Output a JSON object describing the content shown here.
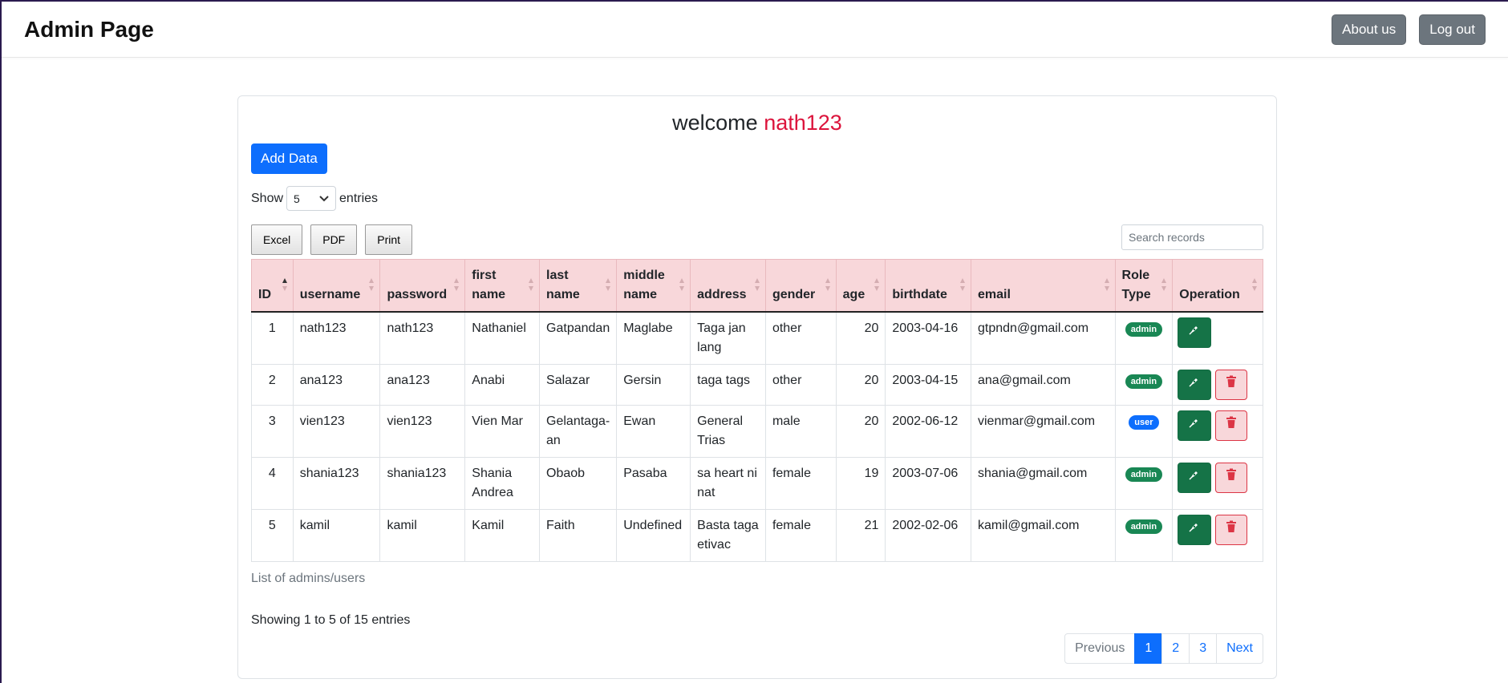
{
  "navbar": {
    "brand": "Admin Page",
    "about_label": "About us",
    "logout_label": "Log out"
  },
  "welcome": {
    "prefix": "welcome",
    "username": "nath123"
  },
  "add_button": "Add Data",
  "length": {
    "show": "Show",
    "value": "5",
    "entries": "entries"
  },
  "export": {
    "excel": "Excel",
    "pdf": "PDF",
    "print": "Print"
  },
  "search": {
    "placeholder": "Search records",
    "value": ""
  },
  "table": {
    "headers": [
      "ID",
      "username",
      "password",
      "first name",
      "last name",
      "middle name",
      "address",
      "gender",
      "age",
      "birthdate",
      "email",
      "Role Type",
      "Operation"
    ],
    "rows": [
      {
        "id": "1",
        "username": "nath123",
        "password": "nath123",
        "first": "Nathaniel",
        "last": "Gatpandan",
        "middle": "Maglabe",
        "address": "Taga jan lang",
        "gender": "other",
        "age": "20",
        "birthdate": "2003-04-16",
        "email": "gtpndn@gmail.com",
        "role": "admin"
      },
      {
        "id": "2",
        "username": "ana123",
        "password": "ana123",
        "first": "Anabi",
        "last": "Salazar",
        "middle": "Gersin",
        "address": "taga tags",
        "gender": "other",
        "age": "20",
        "birthdate": "2003-04-15",
        "email": "ana@gmail.com",
        "role": "admin"
      },
      {
        "id": "3",
        "username": "vien123",
        "password": "vien123",
        "first": "Vien Mar",
        "last": "Gelantaga-an",
        "middle": "Ewan",
        "address": "General Trias",
        "gender": "male",
        "age": "20",
        "birthdate": "2002-06-12",
        "email": "vienmar@gmail.com",
        "role": "user"
      },
      {
        "id": "4",
        "username": "shania123",
        "password": "shania123",
        "first": "Shania Andrea",
        "last": "Obaob",
        "middle": "Pasaba",
        "address": "sa heart ni nat",
        "gender": "female",
        "age": "19",
        "birthdate": "2003-07-06",
        "email": "shania@gmail.com",
        "role": "admin"
      },
      {
        "id": "5",
        "username": "kamil",
        "password": "kamil",
        "first": "Kamil",
        "last": "Faith",
        "middle": "Undefined",
        "address": "Basta taga etivac",
        "gender": "female",
        "age": "21",
        "birthdate": "2002-02-06",
        "email": "kamil@gmail.com",
        "role": "admin"
      }
    ]
  },
  "caption": "List of admins/users",
  "info": "Showing 1 to 5 of 15 entries",
  "pagination": {
    "previous": "Previous",
    "pages": [
      "1",
      "2",
      "3"
    ],
    "next": "Next",
    "active": "1"
  },
  "icons": {
    "edit": "pen-nib-icon",
    "delete": "trash-icon",
    "sort": "sort-icon"
  },
  "colors": {
    "accent": "#0d6efd",
    "success": "#198754",
    "danger": "#dc3545",
    "header_bg": "#f8d7da",
    "welcome_user": "#dc143c"
  }
}
